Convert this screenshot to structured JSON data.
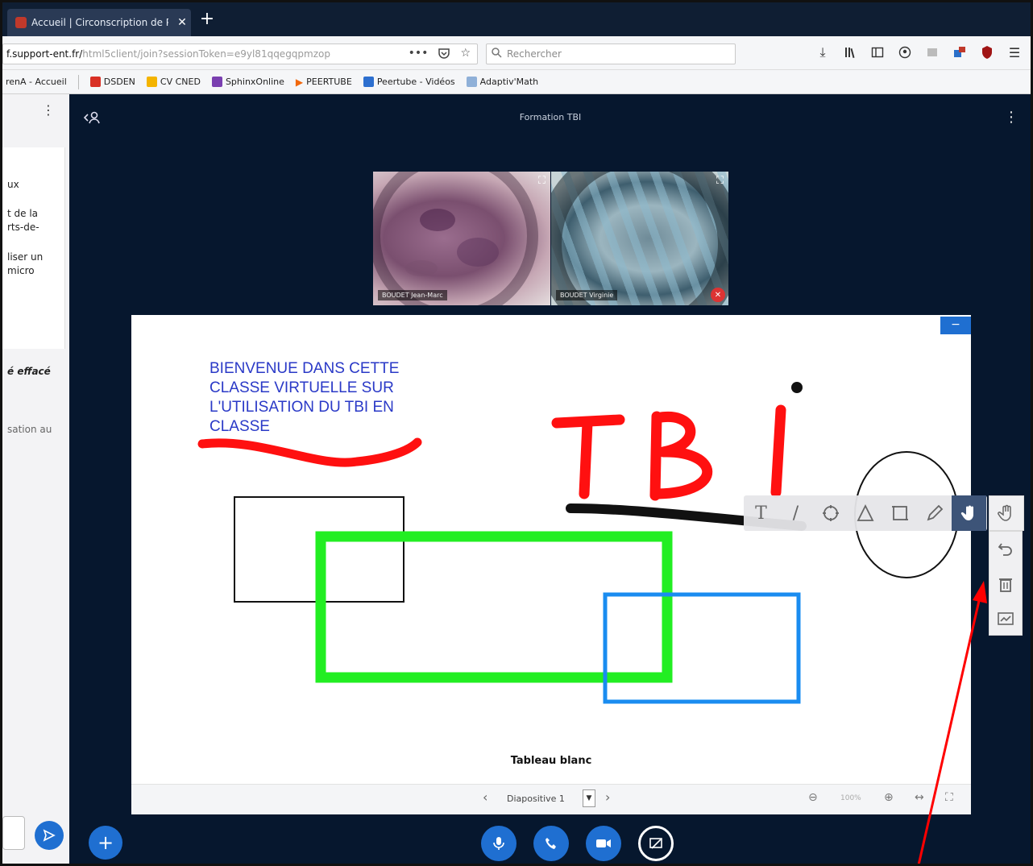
{
  "browser": {
    "tab_title": "Accueil | Circonscription de Pri",
    "tab_close": "✕",
    "new_tab": "+",
    "url_host": "f.support-ent.fr/",
    "url_path": "html5client/join?sessionToken=e9yl81qqegqpmzop",
    "url_dots": "•••",
    "search_placeholder": "Rechercher",
    "bookmarks": [
      {
        "label": "renA - Accueil",
        "color": ""
      },
      {
        "label": "DSDEN",
        "color": "#d93025"
      },
      {
        "label": "CV CNED",
        "color": "#f4b400"
      },
      {
        "label": "SphinxOnline",
        "color": "#7a3fb0"
      },
      {
        "label": "PEERTUBE",
        "color": "#f1680d"
      },
      {
        "label": "Peertube - Vidéos",
        "color": "#2d6fcf"
      },
      {
        "label": "Adaptiv'Math",
        "color": "#8fb0d8"
      }
    ]
  },
  "sidebar": {
    "kebab": "⋮",
    "fragments": [
      "ux",
      "t de la",
      "rts-de-",
      "liser un",
      "micro"
    ],
    "italic_note": "é effacé",
    "grey_note": "sation au"
  },
  "conference": {
    "title": "Formation TBI",
    "users_icon": "‹ 웃",
    "kebab": "⋮",
    "videos": [
      {
        "name": "BOUDET Jean-Marc"
      },
      {
        "name": "BOUDET Virginie"
      }
    ]
  },
  "whiteboard": {
    "minimize": "−",
    "welcome": "BIENVENUE DANS CETTE CLASSE VIRTUELLE SUR L'UTILISATION DU TBI EN CLASSE",
    "tbi": "TBI",
    "footer_label": "Tableau blanc",
    "slide_label": "Diapositive 1",
    "zoom": "100%",
    "colors": {
      "red": "#ff1010",
      "green": "#22ee22",
      "blue": "#1a8cf0",
      "black": "#111111"
    }
  },
  "annotation_tools": {
    "tools": [
      "text-tool",
      "line-tool",
      "ellipse-tool",
      "triangle-tool",
      "rectangle-tool",
      "pencil-tool",
      "hand-tool"
    ],
    "side_tools": [
      "undo-tool",
      "clear-tool",
      "multi-user-tool"
    ]
  },
  "actions": {
    "plus": "+"
  }
}
